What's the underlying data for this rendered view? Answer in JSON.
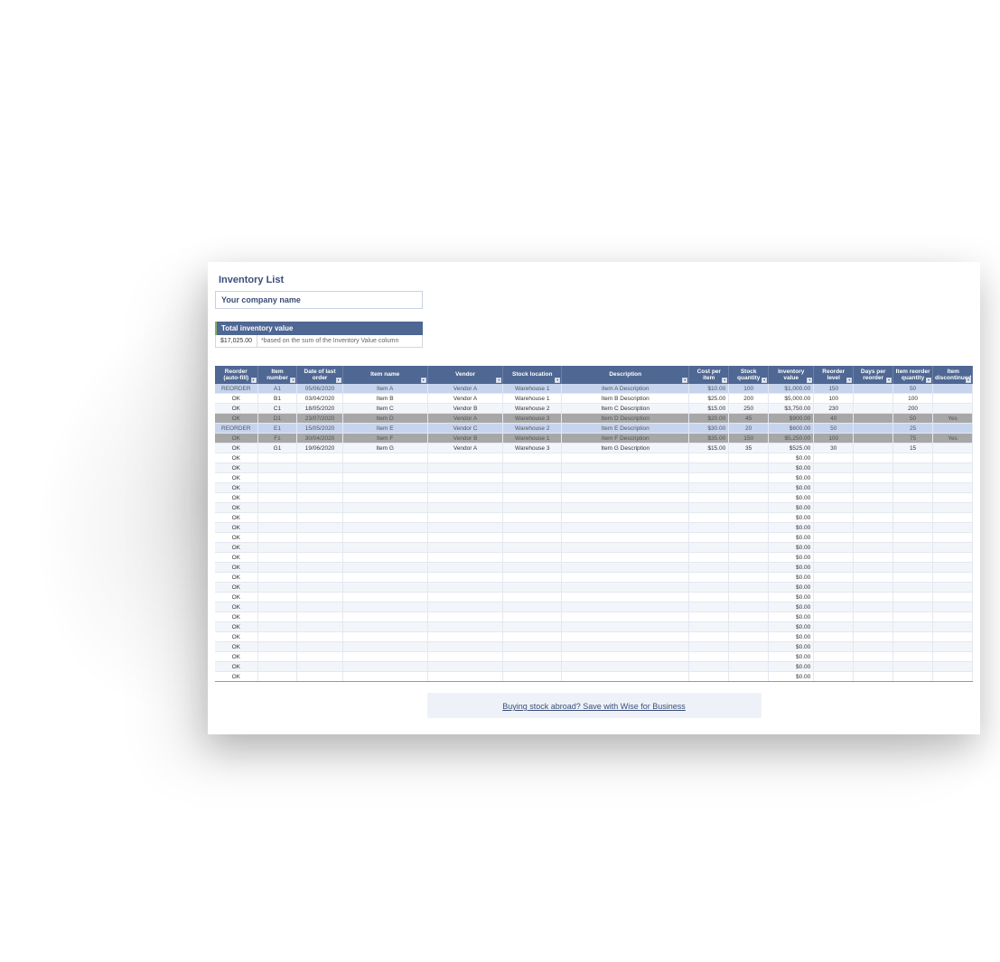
{
  "title": "Inventory List",
  "company_placeholder": "Your company name",
  "total_inventory": {
    "label": "Total inventory value",
    "value": "$17,025.00",
    "note": "*based on the sum of the Inventory Value column"
  },
  "headers": {
    "reorder": "Reorder (auto-fill)",
    "item_number": "Item number",
    "date": "Date of last order",
    "name": "Item name",
    "vendor": "Vendor",
    "location": "Stock location",
    "description": "Description",
    "cost": "Cost per item",
    "qty": "Stock quantity",
    "inv_value": "Inventory value",
    "rlevel": "Reorder level",
    "days": "Days per reorder",
    "rqty": "Item reorder quantity",
    "disc": "Item discontinued"
  },
  "footer_link": "Buying stock abroad? Save with Wise for Business",
  "chart_data": {
    "type": "table",
    "columns": [
      "Reorder (auto-fill)",
      "Item number",
      "Date of last order",
      "Item name",
      "Vendor",
      "Stock location",
      "Description",
      "Cost per item",
      "Stock quantity",
      "Inventory value",
      "Reorder level",
      "Days per reorder",
      "Item reorder quantity",
      "Item discontinued"
    ],
    "rows": [
      {
        "reorder": "REORDER",
        "item": "A1",
        "date": "05/06/2020",
        "name": "Item A",
        "vendor": "Vendor A",
        "location": "Warehouse 1",
        "description": "Item A Description",
        "cost": "$10.00",
        "qty": "100",
        "inv": "$1,000.00",
        "rlvl": "150",
        "days": "",
        "rqty": "50",
        "disc": "",
        "state": "reorder"
      },
      {
        "reorder": "OK",
        "item": "B1",
        "date": "03/04/2020",
        "name": "Item B",
        "vendor": "Vendor A",
        "location": "Warehouse 1",
        "description": "Item B Description",
        "cost": "$25.00",
        "qty": "200",
        "inv": "$5,000.00",
        "rlvl": "100",
        "days": "",
        "rqty": "100",
        "disc": "",
        "state": "odd"
      },
      {
        "reorder": "OK",
        "item": "C1",
        "date": "18/05/2020",
        "name": "Item C",
        "vendor": "Vendor B",
        "location": "Warehouse 2",
        "description": "Item C Description",
        "cost": "$15.00",
        "qty": "250",
        "inv": "$3,750.00",
        "rlvl": "230",
        "days": "",
        "rqty": "200",
        "disc": "",
        "state": "even"
      },
      {
        "reorder": "OK",
        "item": "D1",
        "date": "23/07/2020",
        "name": "Item D",
        "vendor": "Vendor A",
        "location": "Warehouse 3",
        "description": "Item D Description",
        "cost": "$20.00",
        "qty": "45",
        "inv": "$900.00",
        "rlvl": "40",
        "days": "",
        "rqty": "50",
        "disc": "Yes",
        "state": "disc"
      },
      {
        "reorder": "REORDER",
        "item": "E1",
        "date": "15/05/2020",
        "name": "Item E",
        "vendor": "Vendor C",
        "location": "Warehouse 2",
        "description": "Item E Description",
        "cost": "$30.00",
        "qty": "20",
        "inv": "$600.00",
        "rlvl": "50",
        "days": "",
        "rqty": "25",
        "disc": "",
        "state": "reorder"
      },
      {
        "reorder": "OK",
        "item": "F1",
        "date": "30/04/2020",
        "name": "Item F",
        "vendor": "Vendor B",
        "location": "Warehouse 1",
        "description": "Item F Description",
        "cost": "$35.00",
        "qty": "150",
        "inv": "$5,250.00",
        "rlvl": "100",
        "days": "",
        "rqty": "75",
        "disc": "Yes",
        "state": "disc"
      },
      {
        "reorder": "OK",
        "item": "G1",
        "date": "19/06/2020",
        "name": "Item G",
        "vendor": "Vendor A",
        "location": "Warehouse 3",
        "description": "Item G Description",
        "cost": "$15.00",
        "qty": "35",
        "inv": "$525.00",
        "rlvl": "30",
        "days": "",
        "rqty": "15",
        "disc": "",
        "state": "even"
      }
    ],
    "empty_rows": 23,
    "empty_template": {
      "reorder": "OK",
      "inv": "$0.00"
    }
  }
}
